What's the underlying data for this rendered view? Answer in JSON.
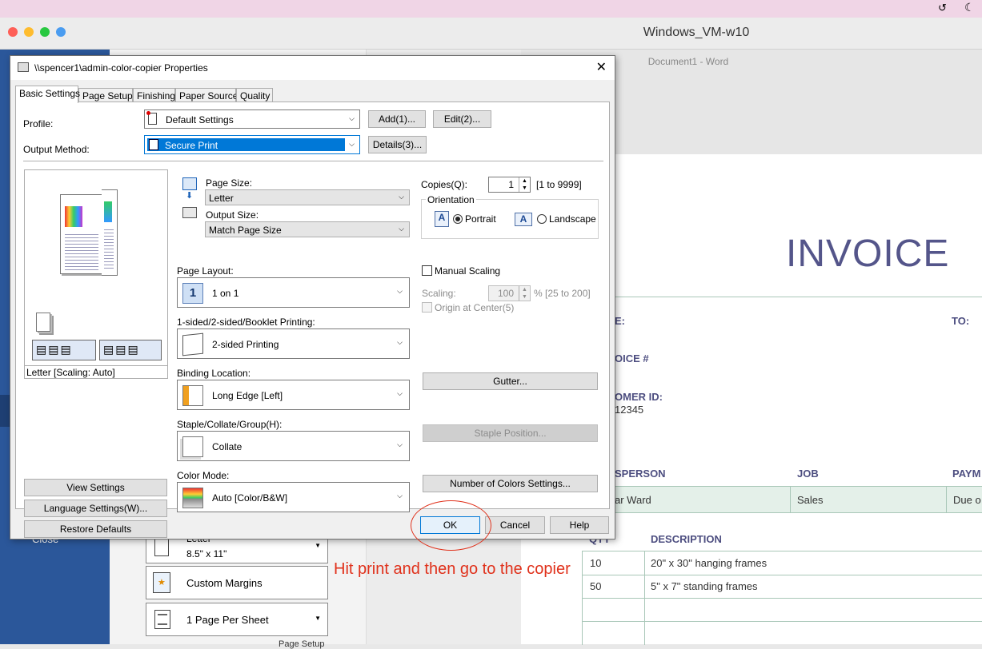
{
  "vm": {
    "title": "Windows_VM-w10"
  },
  "word": {
    "doc_title": "Document1  -  Word",
    "backstage_close": "Close",
    "print_options": [
      {
        "label": "Letter",
        "sub": "8.5\" x 11\""
      },
      {
        "label": "Custom Margins"
      },
      {
        "label": "1 Page Per Sheet"
      }
    ],
    "page_setup_link": "Page Setup",
    "invoice": {
      "heading": "INVOICE",
      "date_label": "E:",
      "to_label": "TO:",
      "invoice_no_label": "OICE #",
      "customer_id_label": "OMER ID:",
      "customer_id": "12345",
      "columns": [
        "SPERSON",
        "JOB",
        "PAYM"
      ],
      "row": [
        "ar Ward",
        "Sales",
        "Due o"
      ],
      "items_header": [
        "QTY",
        "DESCRIPTION"
      ],
      "items": [
        {
          "qty": "10",
          "desc": "20\" x 30\" hanging frames"
        },
        {
          "qty": "50",
          "desc": "5\" x 7\" standing frames"
        }
      ]
    }
  },
  "dialog": {
    "title": "\\\\spencer1\\admin-color-copier Properties",
    "tabs": [
      "Basic Settings",
      "Page Setup",
      "Finishing",
      "Paper Source",
      "Quality"
    ],
    "profile_label": "Profile:",
    "profile_value": "Default Settings",
    "add_button": "Add(1)...",
    "edit_button": "Edit(2)...",
    "output_method_label": "Output Method:",
    "output_method_value": "Secure Print",
    "details_button": "Details(3)...",
    "preview_caption": "Letter [Scaling: Auto]",
    "view_settings": "View Settings",
    "language_settings": "Language Settings(W)...",
    "restore_defaults": "Restore Defaults",
    "page_size_label": "Page Size:",
    "page_size_value": "Letter",
    "output_size_label": "Output Size:",
    "output_size_value": "Match Page Size",
    "copies_label": "Copies(Q):",
    "copies_value": "1",
    "copies_range": "[1 to 9999]",
    "orientation_label": "Orientation",
    "portrait": "Portrait",
    "landscape": "Landscape",
    "page_layout_label": "Page Layout:",
    "page_layout_value": "1 on 1",
    "page_layout_icon": "1",
    "manual_scaling": "Manual Scaling",
    "scaling_label": "Scaling:",
    "scaling_value": "100",
    "scaling_range": "% [25 to 200]",
    "origin_center": "Origin at Center(5)",
    "sided_label": "1-sided/2-sided/Booklet Printing:",
    "sided_value": "2-sided Printing",
    "binding_label": "Binding Location:",
    "binding_value": "Long Edge [Left]",
    "gutter_button": "Gutter...",
    "staple_label": "Staple/Collate/Group(H):",
    "staple_value": "Collate",
    "staple_position_button": "Staple Position...",
    "color_mode_label": "Color Mode:",
    "color_mode_value": "Auto [Color/B&W]",
    "number_colors_button": "Number of Colors Settings...",
    "ok_button": "OK",
    "cancel_button": "Cancel",
    "help_button": "Help"
  },
  "annotation": {
    "text": "Hit print and then go to the copier",
    "color": "#e0311b"
  },
  "colors": {
    "word_blue": "#2b579a",
    "invoice_purple": "#54558a",
    "selection_blue": "#0078d7"
  }
}
